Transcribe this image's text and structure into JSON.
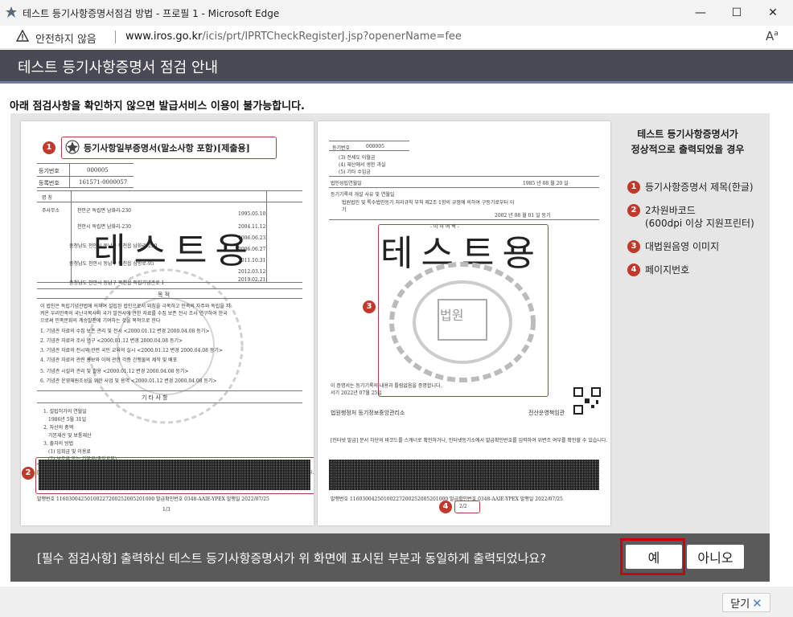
{
  "window": {
    "title": "테스트 등기사항증명서점검 방법 - 프로필 1 - Microsoft Edge",
    "minimize_glyph": "—",
    "maximize_glyph": "☐",
    "close_glyph": "✕"
  },
  "address_bar": {
    "security_label": "안전하지 않음",
    "url_host": "www.iros.go.kr",
    "url_path": "/icis/prt/IPRTCheckRegisterJ.jsp?openerName=fee",
    "read_aloud_glyph": "Aᵃ"
  },
  "header": {
    "title": "테스트 등기사항증명서 점검 안내"
  },
  "notice": "아래 점검사항을 확인하지 않으면 발급서비스 이용이 불가능합니다.",
  "preview": {
    "page1": {
      "doc_title": "등기사항일부증명서(말소사항 포함)[제출용]",
      "reg_no_label": "등기번호",
      "reg_no": "000005",
      "biz_no_label": "등록번호",
      "biz_no": "161571-0000057",
      "watermark": "테스트용",
      "reason_title": "목 적",
      "misc_title": "기 타 사 항",
      "page_number": "1/3"
    },
    "page2": {
      "reg_no_label": "등기번호",
      "reg_no": "000005",
      "watermark": "테스트용",
      "below_text": "- 이 하 여 백 -",
      "seal_text": "법원",
      "office": "법원행정처 등기정보중앙관리소",
      "officer": "전산운영책임관",
      "page_number": "2/2"
    }
  },
  "legend": {
    "title_line1": "테스트 등기사항증명서가",
    "title_line2": "정상적으로 출력되었을 경우",
    "items": [
      {
        "number": "1",
        "label": "등기사항증명서 제목(한글)"
      },
      {
        "number": "2",
        "label": "2차원바코드",
        "sublabel": "(600dpi 이상 지원프린터)"
      },
      {
        "number": "3",
        "label": "대법원음영 이미지"
      },
      {
        "number": "4",
        "label": "페이지번호"
      }
    ]
  },
  "confirm": {
    "question": "[필수 점검사항] 출력하신 테스트 등기사항증명서가 위 화면에 표시된 부분과 동일하게 출력되었나요?",
    "yes_label": "예",
    "no_label": "아니오"
  },
  "footer": {
    "close_label": "닫기"
  },
  "colors": {
    "header_bg": "#4a4a56",
    "marker_red": "#c0392b",
    "confirm_bg": "#5a5a5a",
    "yes_outline": "#d00000"
  }
}
